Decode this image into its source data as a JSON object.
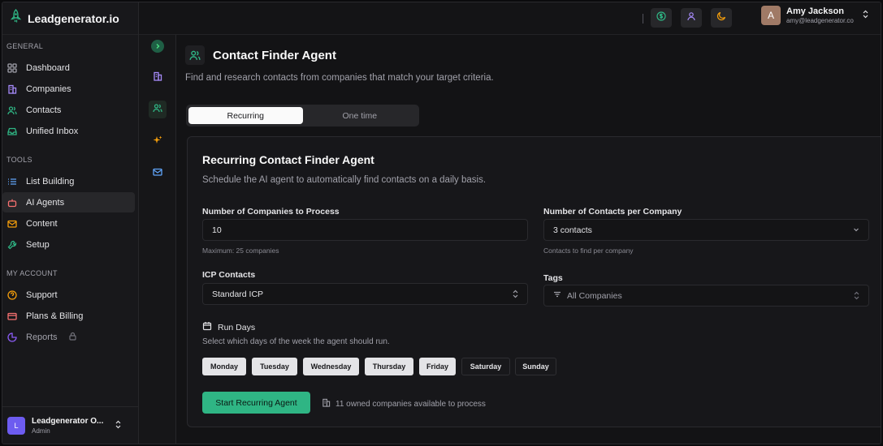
{
  "brand": {
    "name": "Leadgenerator.io",
    "accent": "#2fb584"
  },
  "sidebar": {
    "sections": [
      {
        "label": "GENERAL",
        "items": [
          {
            "label": "Dashboard",
            "icon": "grid-icon"
          },
          {
            "label": "Companies",
            "icon": "building-icon"
          },
          {
            "label": "Contacts",
            "icon": "users-icon"
          },
          {
            "label": "Unified Inbox",
            "icon": "inbox-icon"
          }
        ]
      },
      {
        "label": "TOOLS",
        "items": [
          {
            "label": "List Building",
            "icon": "list-icon"
          },
          {
            "label": "AI Agents",
            "icon": "bot-icon",
            "active": true
          },
          {
            "label": "Content",
            "icon": "mail-icon"
          },
          {
            "label": "Setup",
            "icon": "wrench-icon"
          }
        ]
      },
      {
        "label": "MY ACCOUNT",
        "items": [
          {
            "label": "Support",
            "icon": "help-circle-icon"
          },
          {
            "label": "Plans & Billing",
            "icon": "credit-card-icon"
          },
          {
            "label": "Reports",
            "icon": "pie-chart-icon",
            "locked": true
          }
        ]
      }
    ],
    "org": {
      "initial": "L",
      "name": "Leadgenerator O...",
      "role": "Admin"
    }
  },
  "topbar": {
    "user": {
      "initial": "A",
      "name": "Amy Jackson",
      "email": "amy@leadgenerator.co"
    }
  },
  "page": {
    "title": "Contact Finder Agent",
    "description": "Find and research contacts from companies that match your target criteria.",
    "tabs": [
      {
        "label": "Recurring",
        "selected": true
      },
      {
        "label": "One time",
        "selected": false
      }
    ]
  },
  "card": {
    "title": "Recurring Contact Finder Agent",
    "description": "Schedule the AI agent to automatically find contacts on a daily basis.",
    "companies_label": "Number of Companies to Process",
    "companies_value": "10",
    "companies_help": "Maximum: 25 companies",
    "contacts_label": "Number of Contacts per Company",
    "contacts_value": "3 contacts",
    "contacts_help": "Contacts to find per company",
    "icp_label": "ICP Contacts",
    "icp_value": "Standard ICP",
    "tags_label": "Tags",
    "tags_value": "All Companies",
    "run_days_label": "Run Days",
    "run_days_help": "Select which days of the week the agent should run.",
    "days": [
      {
        "label": "Monday",
        "selected": true
      },
      {
        "label": "Tuesday",
        "selected": true
      },
      {
        "label": "Wednesday",
        "selected": true
      },
      {
        "label": "Thursday",
        "selected": true
      },
      {
        "label": "Friday",
        "selected": true
      },
      {
        "label": "Saturday",
        "selected": false
      },
      {
        "label": "Sunday",
        "selected": false
      }
    ],
    "start_label": "Start Recurring Agent",
    "available_text": "11 owned companies available to process"
  }
}
